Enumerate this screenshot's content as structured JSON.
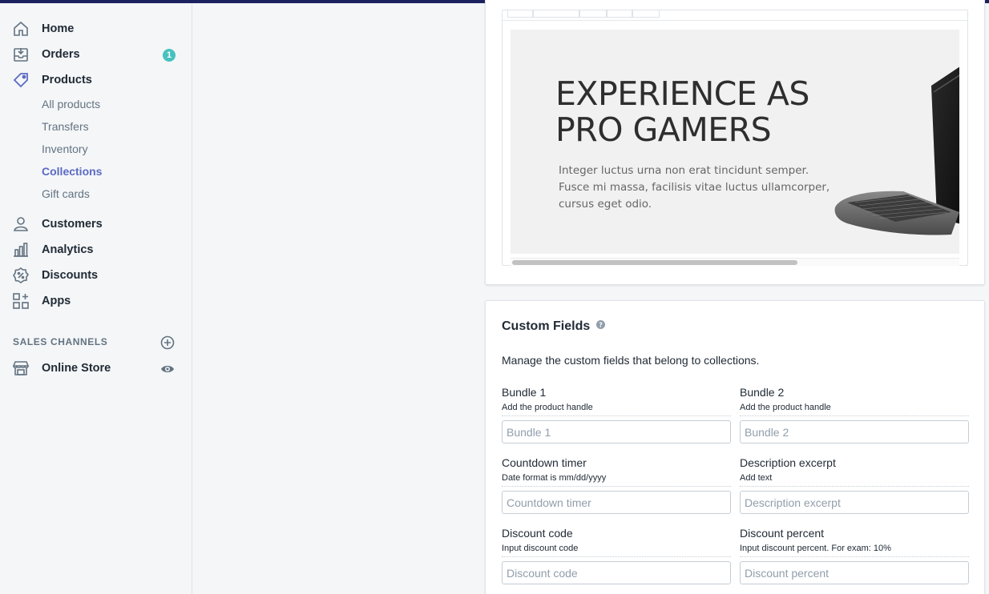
{
  "nav": {
    "items": [
      {
        "label": "Home",
        "icon": "home-icon"
      },
      {
        "label": "Orders",
        "icon": "orders-icon",
        "badge": "1"
      },
      {
        "label": "Products",
        "icon": "tag-icon"
      }
    ],
    "products_sub": [
      {
        "label": "All products"
      },
      {
        "label": "Transfers"
      },
      {
        "label": "Inventory"
      },
      {
        "label": "Collections",
        "active": true
      },
      {
        "label": "Gift cards"
      }
    ],
    "more_items": [
      {
        "label": "Customers",
        "icon": "person-icon"
      },
      {
        "label": "Analytics",
        "icon": "bar-chart-icon"
      },
      {
        "label": "Discounts",
        "icon": "discount-icon"
      },
      {
        "label": "Apps",
        "icon": "apps-icon"
      }
    ],
    "sales_channels_heading": "SALES CHANNELS",
    "online_store": {
      "label": "Online Store",
      "icon": "store-icon"
    }
  },
  "preview": {
    "banner_title": "EXPERIENCE AS PRO GAMERS",
    "banner_text": "Integer luctus urna non erat tincidunt semper. Fusce mi massa, facilisis vitae luctus ullamcorper, cursus eget odio."
  },
  "custom_fields": {
    "title": "Custom Fields",
    "description": "Manage the custom fields that belong to collections.",
    "fields": [
      {
        "label": "Bundle 1",
        "help": "Add the product handle",
        "placeholder": "Bundle 1",
        "value": ""
      },
      {
        "label": "Bundle 2",
        "help": "Add the product handle",
        "placeholder": "Bundle 2",
        "value": ""
      },
      {
        "label": "Countdown timer",
        "help": "Date format is mm/dd/yyyy",
        "placeholder": "Countdown timer",
        "value": ""
      },
      {
        "label": "Description excerpt",
        "help": "Add text",
        "placeholder": "Description excerpt",
        "value": ""
      },
      {
        "label": "Discount code",
        "help": "Input discount code",
        "placeholder": "Discount code",
        "value": ""
      },
      {
        "label": "Discount percent",
        "help": "Input discount percent. For exam: 10%",
        "placeholder": "Discount percent",
        "value": ""
      }
    ]
  },
  "colors": {
    "accent": "#5c6ac4",
    "badge": "#47c1bf",
    "topbar": "#1c2260"
  }
}
